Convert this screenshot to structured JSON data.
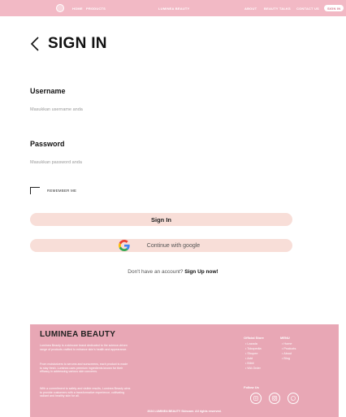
{
  "nav": {
    "home": "HOME",
    "products": "PRODUCTS",
    "brand": "LUMINEA BEAUTY",
    "about": "ABOUT",
    "beauty_talks": "BEAUTY TALKS",
    "contact": "CONTACT US",
    "sign_in": "SIGN IN"
  },
  "colors": {
    "nav_bg": "#f2b9c5",
    "button_bg": "#f8ded8",
    "footer_bg": "#e8a7b5"
  },
  "page": {
    "title": "SIGN IN"
  },
  "form": {
    "username_label": "Username",
    "username_placeholder": "Masukkan username anda",
    "password_label": "Password",
    "password_placeholder": "Masukkan password anda",
    "remember_label": "REMEMBER ME",
    "signin_button": "Sign In",
    "google_button": "Continue with google",
    "signup_prompt": "Don't have an account?",
    "signup_link": "Sign Up now!"
  },
  "footer": {
    "brand": "LUMINEA BEAUTY",
    "para1": "Luminea Beauty is a skincare brand dedicated to the science-driven range of products crafted to enhance skin's health and appearance.",
    "para2": "From moisturizers to serums and sunscreens, each product is made to stay fresh. Luminea uses premium ingredients known for their efficacy in addressing various skin concerns.",
    "para3": "With a commitment to safety and visible results, Luminea Beauty aims to provide customers with a transformative experience, cultivating radiant and healthy skin for all.",
    "store_title": "Official Store",
    "store_items": [
      "Lazada",
      "Tokopedia",
      "Shopee",
      "Add",
      "Blibli",
      "WA Order"
    ],
    "menu_title": "MENU",
    "menu_items": [
      "Home",
      "Products",
      "About",
      "Blog"
    ],
    "follow_title": "Follow Us",
    "copyright": "2024 LUMINEA BEAUTY Skincare. All rights reserved."
  },
  "icons": {
    "back": "chevron-left-icon",
    "google": "google-icon",
    "social1": "tiktok-icon",
    "social2": "instagram-icon",
    "social3": "whatsapp-icon"
  }
}
